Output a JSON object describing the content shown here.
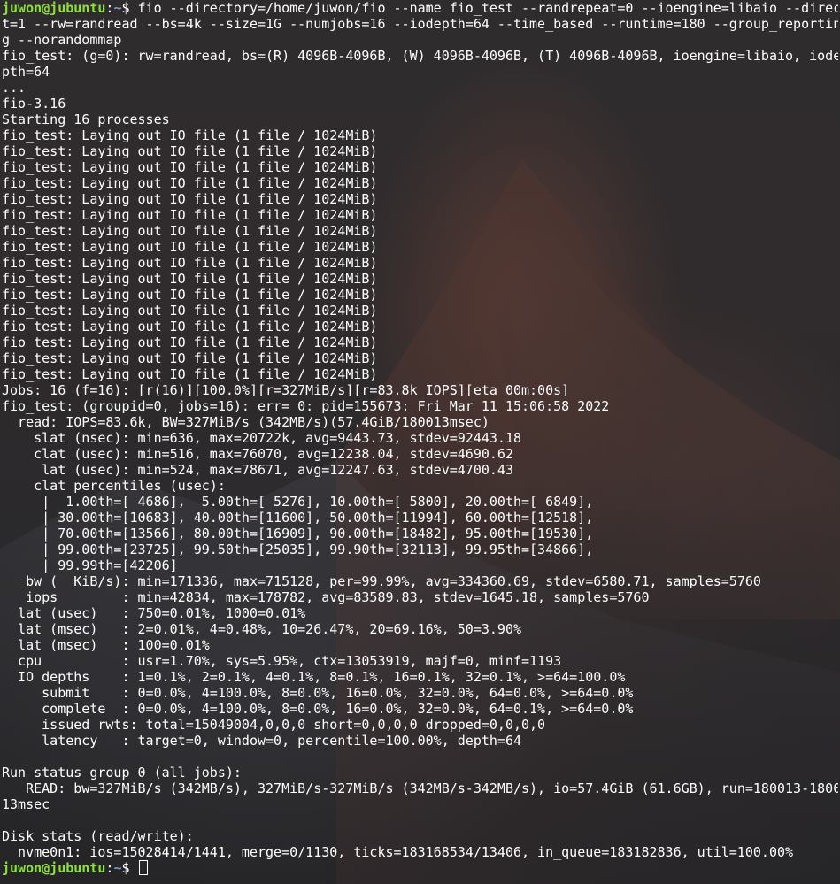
{
  "prompt": {
    "user_host": "juwon@jubuntu",
    "separator": ":",
    "path": "~",
    "symbol": "$ "
  },
  "command_lines": [
    "fio --directory=/home/juwon/fio --name fio_test --randrepeat=0 --ioengine=libaio --direc",
    "t=1 --rw=randread --bs=4k --size=1G --numjobs=16 --iodepth=64 --time_based --runtime=180 --group_reportin",
    "g --norandommap"
  ],
  "output_lines": [
    "fio_test: (g=0): rw=randread, bs=(R) 4096B-4096B, (W) 4096B-4096B, (T) 4096B-4096B, ioengine=libaio, iode",
    "pth=64",
    "...",
    "fio-3.16",
    "Starting 16 processes",
    "fio_test: Laying out IO file (1 file / 1024MiB)",
    "fio_test: Laying out IO file (1 file / 1024MiB)",
    "fio_test: Laying out IO file (1 file / 1024MiB)",
    "fio_test: Laying out IO file (1 file / 1024MiB)",
    "fio_test: Laying out IO file (1 file / 1024MiB)",
    "fio_test: Laying out IO file (1 file / 1024MiB)",
    "fio_test: Laying out IO file (1 file / 1024MiB)",
    "fio_test: Laying out IO file (1 file / 1024MiB)",
    "fio_test: Laying out IO file (1 file / 1024MiB)",
    "fio_test: Laying out IO file (1 file / 1024MiB)",
    "fio_test: Laying out IO file (1 file / 1024MiB)",
    "fio_test: Laying out IO file (1 file / 1024MiB)",
    "fio_test: Laying out IO file (1 file / 1024MiB)",
    "fio_test: Laying out IO file (1 file / 1024MiB)",
    "fio_test: Laying out IO file (1 file / 1024MiB)",
    "fio_test: Laying out IO file (1 file / 1024MiB)",
    "Jobs: 16 (f=16): [r(16)][100.0%][r=327MiB/s][r=83.8k IOPS][eta 00m:00s]",
    "fio_test: (groupid=0, jobs=16): err= 0: pid=155673: Fri Mar 11 15:06:58 2022",
    "  read: IOPS=83.6k, BW=327MiB/s (342MB/s)(57.4GiB/180013msec)",
    "    slat (nsec): min=636, max=20722k, avg=9443.73, stdev=92443.18",
    "    clat (usec): min=516, max=76070, avg=12238.04, stdev=4690.62",
    "     lat (usec): min=524, max=78671, avg=12247.63, stdev=4700.43",
    "    clat percentiles (usec):",
    "     |  1.00th=[ 4686],  5.00th=[ 5276], 10.00th=[ 5800], 20.00th=[ 6849],",
    "     | 30.00th=[10683], 40.00th=[11600], 50.00th=[11994], 60.00th=[12518],",
    "     | 70.00th=[13566], 80.00th=[16909], 90.00th=[18482], 95.00th=[19530],",
    "     | 99.00th=[23725], 99.50th=[25035], 99.90th=[32113], 99.95th=[34866],",
    "     | 99.99th=[42206]",
    "   bw (  KiB/s): min=171336, max=715128, per=99.99%, avg=334360.69, stdev=6580.71, samples=5760",
    "   iops        : min=42834, max=178782, avg=83589.83, stdev=1645.18, samples=5760",
    "  lat (usec)   : 750=0.01%, 1000=0.01%",
    "  lat (msec)   : 2=0.01%, 4=0.48%, 10=26.47%, 20=69.16%, 50=3.90%",
    "  lat (msec)   : 100=0.01%",
    "  cpu          : usr=1.70%, sys=5.95%, ctx=13053919, majf=0, minf=1193",
    "  IO depths    : 1=0.1%, 2=0.1%, 4=0.1%, 8=0.1%, 16=0.1%, 32=0.1%, >=64=100.0%",
    "     submit    : 0=0.0%, 4=100.0%, 8=0.0%, 16=0.0%, 32=0.0%, 64=0.0%, >=64=0.0%",
    "     complete  : 0=0.0%, 4=100.0%, 8=0.0%, 16=0.0%, 32=0.0%, 64=0.1%, >=64=0.0%",
    "     issued rwts: total=15049004,0,0,0 short=0,0,0,0 dropped=0,0,0,0",
    "     latency   : target=0, window=0, percentile=100.00%, depth=64",
    "",
    "Run status group 0 (all jobs):",
    "   READ: bw=327MiB/s (342MB/s), 327MiB/s-327MiB/s (342MB/s-342MB/s), io=57.4GiB (61.6GB), run=180013-1800",
    "13msec",
    "",
    "Disk stats (read/write):",
    "  nvme0n1: ios=15028414/1441, merge=0/1130, ticks=183168534/13406, in_queue=183182836, util=100.00%"
  ],
  "colors": {
    "text": "#ffffff",
    "user_host": "#8ae234",
    "path": "#729fcf",
    "background": "#2b2a2c"
  },
  "icons": {
    "cursor": "block-cursor-outline"
  }
}
